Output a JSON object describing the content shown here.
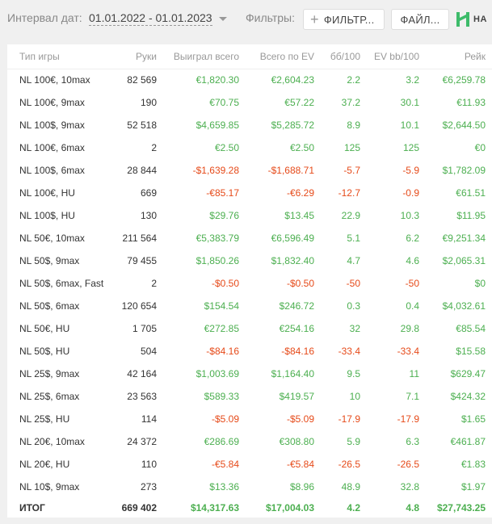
{
  "toolbar": {
    "date_label": "Интервал дат:",
    "date_range": "01.01.2022 - 01.01.2023",
    "filters_label": "Фильтры:",
    "filter_button": "ФИЛЬТР...",
    "file_button": "ФАЙЛ...",
    "logo_text": "НА",
    "logo_color": "#3dbb6a"
  },
  "colors": {
    "positive": "#4caf50",
    "negative": "#e64a19"
  },
  "table": {
    "columns": [
      "Тип игры",
      "Руки",
      "Выиграл всего",
      "Всего по EV",
      "бб/100",
      "EV bb/100",
      "Рейк"
    ],
    "rows": [
      {
        "game": "NL 100€, 10max",
        "hands": "82 569",
        "won": "€1,820.30",
        "ev": "€2,604.23",
        "bb100": "2.2",
        "evbb100": "3.2",
        "rake": "€6,259.78",
        "s": [
          "pos",
          "pos",
          "pos",
          "pos",
          "pos"
        ]
      },
      {
        "game": "NL 100€, 9max",
        "hands": "190",
        "won": "€70.75",
        "ev": "€57.22",
        "bb100": "37.2",
        "evbb100": "30.1",
        "rake": "€11.93",
        "s": [
          "pos",
          "pos",
          "pos",
          "pos",
          "pos"
        ]
      },
      {
        "game": "NL 100$, 9max",
        "hands": "52 518",
        "won": "$4,659.85",
        "ev": "$5,285.72",
        "bb100": "8.9",
        "evbb100": "10.1",
        "rake": "$2,644.50",
        "s": [
          "pos",
          "pos",
          "pos",
          "pos",
          "pos"
        ]
      },
      {
        "game": "NL 100€, 6max",
        "hands": "2",
        "won": "€2.50",
        "ev": "€2.50",
        "bb100": "125",
        "evbb100": "125",
        "rake": "€0",
        "s": [
          "pos",
          "pos",
          "pos",
          "pos",
          "pos"
        ]
      },
      {
        "game": "NL 100$, 6max",
        "hands": "28 844",
        "won": "-$1,639.28",
        "ev": "-$1,688.71",
        "bb100": "-5.7",
        "evbb100": "-5.9",
        "rake": "$1,782.09",
        "s": [
          "neg",
          "neg",
          "neg",
          "neg",
          "pos"
        ]
      },
      {
        "game": "NL 100€, HU",
        "hands": "669",
        "won": "-€85.17",
        "ev": "-€6.29",
        "bb100": "-12.7",
        "evbb100": "-0.9",
        "rake": "€61.51",
        "s": [
          "neg",
          "neg",
          "neg",
          "neg",
          "pos"
        ]
      },
      {
        "game": "NL 100$, HU",
        "hands": "130",
        "won": "$29.76",
        "ev": "$13.45",
        "bb100": "22.9",
        "evbb100": "10.3",
        "rake": "$11.95",
        "s": [
          "pos",
          "pos",
          "pos",
          "pos",
          "pos"
        ]
      },
      {
        "game": "NL 50€, 10max",
        "hands": "211 564",
        "won": "€5,383.79",
        "ev": "€6,596.49",
        "bb100": "5.1",
        "evbb100": "6.2",
        "rake": "€9,251.34",
        "s": [
          "pos",
          "pos",
          "pos",
          "pos",
          "pos"
        ]
      },
      {
        "game": "NL 50$, 9max",
        "hands": "79 455",
        "won": "$1,850.26",
        "ev": "$1,832.40",
        "bb100": "4.7",
        "evbb100": "4.6",
        "rake": "$2,065.31",
        "s": [
          "pos",
          "pos",
          "pos",
          "pos",
          "pos"
        ]
      },
      {
        "game": "NL 50$, 6max, Fast",
        "hands": "2",
        "won": "-$0.50",
        "ev": "-$0.50",
        "bb100": "-50",
        "evbb100": "-50",
        "rake": "$0",
        "s": [
          "neg",
          "neg",
          "neg",
          "neg",
          "pos"
        ]
      },
      {
        "game": "NL 50$, 6max",
        "hands": "120 654",
        "won": "$154.54",
        "ev": "$246.72",
        "bb100": "0.3",
        "evbb100": "0.4",
        "rake": "$4,032.61",
        "s": [
          "pos",
          "pos",
          "pos",
          "pos",
          "pos"
        ]
      },
      {
        "game": "NL 50€, HU",
        "hands": "1 705",
        "won": "€272.85",
        "ev": "€254.16",
        "bb100": "32",
        "evbb100": "29.8",
        "rake": "€85.54",
        "s": [
          "pos",
          "pos",
          "pos",
          "pos",
          "pos"
        ]
      },
      {
        "game": "NL 50$, HU",
        "hands": "504",
        "won": "-$84.16",
        "ev": "-$84.16",
        "bb100": "-33.4",
        "evbb100": "-33.4",
        "rake": "$15.58",
        "s": [
          "neg",
          "neg",
          "neg",
          "neg",
          "pos"
        ]
      },
      {
        "game": "NL 25$, 9max",
        "hands": "42 164",
        "won": "$1,003.69",
        "ev": "$1,164.40",
        "bb100": "9.5",
        "evbb100": "11",
        "rake": "$629.47",
        "s": [
          "pos",
          "pos",
          "pos",
          "pos",
          "pos"
        ]
      },
      {
        "game": "NL 25$, 6max",
        "hands": "23 563",
        "won": "$589.33",
        "ev": "$419.57",
        "bb100": "10",
        "evbb100": "7.1",
        "rake": "$424.32",
        "s": [
          "pos",
          "pos",
          "pos",
          "pos",
          "pos"
        ]
      },
      {
        "game": "NL 25$, HU",
        "hands": "114",
        "won": "-$5.09",
        "ev": "-$5.09",
        "bb100": "-17.9",
        "evbb100": "-17.9",
        "rake": "$1.65",
        "s": [
          "neg",
          "neg",
          "neg",
          "neg",
          "pos"
        ]
      },
      {
        "game": "NL 20€, 10max",
        "hands": "24 372",
        "won": "€286.69",
        "ev": "€308.80",
        "bb100": "5.9",
        "evbb100": "6.3",
        "rake": "€461.87",
        "s": [
          "pos",
          "pos",
          "pos",
          "pos",
          "pos"
        ]
      },
      {
        "game": "NL 20€, HU",
        "hands": "110",
        "won": "-€5.84",
        "ev": "-€5.84",
        "bb100": "-26.5",
        "evbb100": "-26.5",
        "rake": "€1.83",
        "s": [
          "neg",
          "neg",
          "neg",
          "neg",
          "pos"
        ]
      },
      {
        "game": "NL 10$, 9max",
        "hands": "273",
        "won": "$13.36",
        "ev": "$8.96",
        "bb100": "48.9",
        "evbb100": "32.8",
        "rake": "$1.97",
        "s": [
          "pos",
          "pos",
          "pos",
          "pos",
          "pos"
        ]
      }
    ],
    "total": {
      "game": "ИТОГ",
      "hands": "669 402",
      "won": "$14,317.63",
      "ev": "$17,004.03",
      "bb100": "4.2",
      "evbb100": "4.8",
      "rake": "$27,743.25"
    }
  }
}
